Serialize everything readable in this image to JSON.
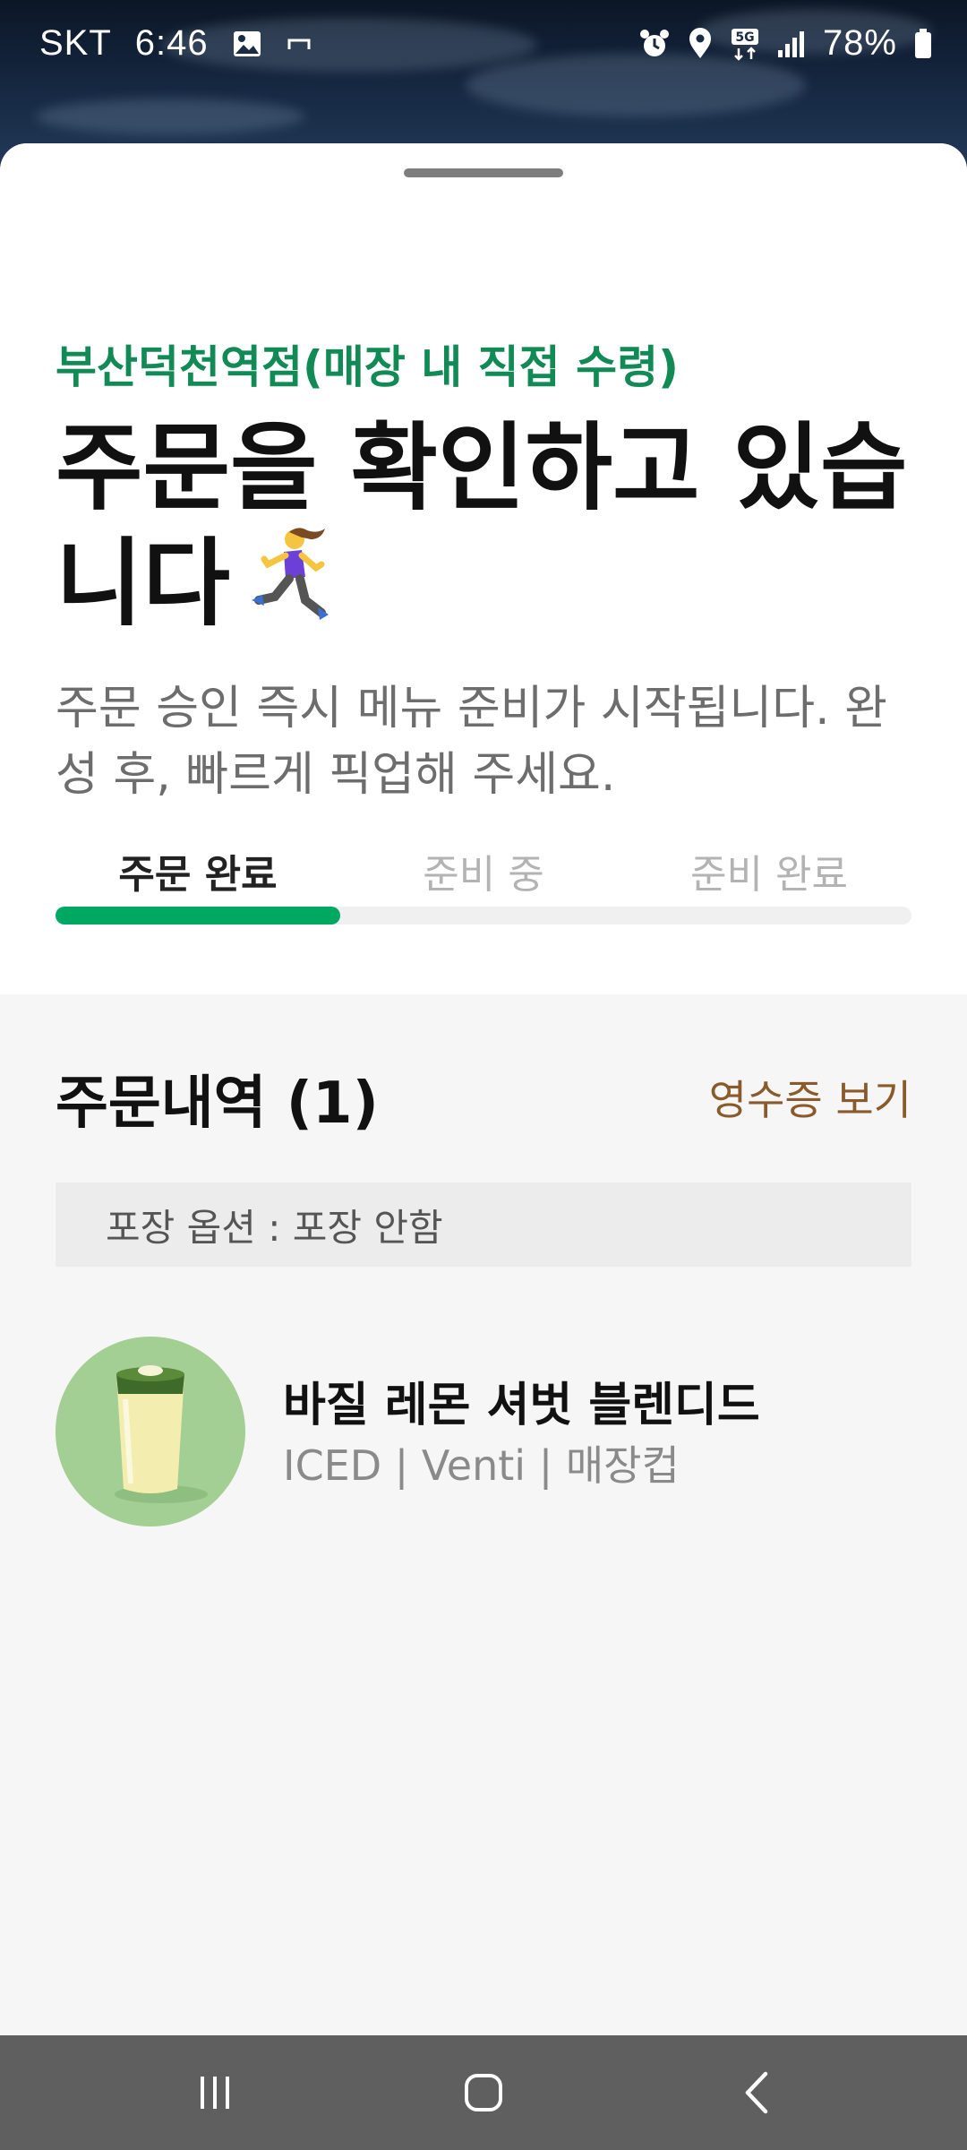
{
  "status_bar": {
    "carrier": "SKT",
    "time": "6:46",
    "battery": "78%",
    "network": "5G",
    "icons": [
      "gallery-icon",
      "minus-icon",
      "alarm-icon",
      "location-icon",
      "5g-icon",
      "signal-icon",
      "battery-icon"
    ]
  },
  "order": {
    "store_name": "부산덕천역점(매장 내 직접 수령)",
    "headline": "주문을 확인하고 있습니다",
    "description": "주문 승인 즉시 메뉴 준비가 시작됩니다. 완성 후, 빠르게 픽업해 주세요.",
    "steps": [
      "주문 완료",
      "준비 중",
      "준비 완료"
    ],
    "active_step": 1,
    "progress": 0.333
  },
  "history": {
    "title": "주문내역 (1)",
    "receipt_label": "영수증 보기",
    "packaging": "포장 옵션 : 포장 안함",
    "items": [
      {
        "name": "바질 레몬 셔벗 블렌디드",
        "options": "ICED | Venti | 매장컵"
      }
    ]
  },
  "colors": {
    "accent_green": "#00a862",
    "store_green": "#118a55",
    "receipt_brown": "#8a5a2b",
    "thumb_bg": "#a3cf94"
  },
  "nav": {
    "icons": [
      "recent-apps-icon",
      "home-icon",
      "back-icon"
    ]
  }
}
